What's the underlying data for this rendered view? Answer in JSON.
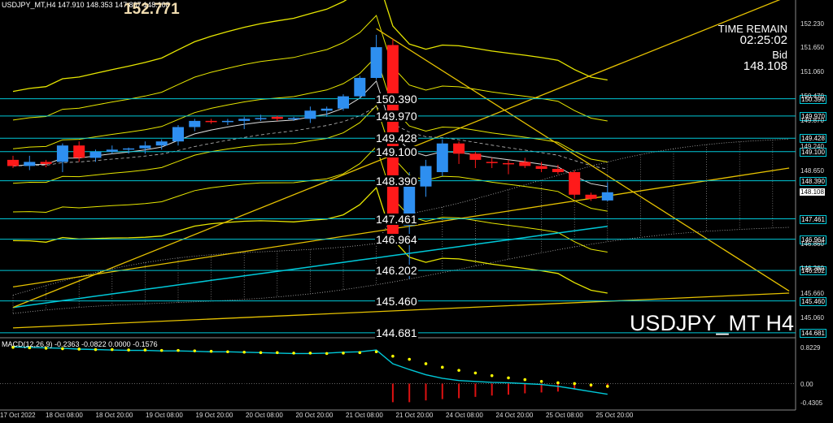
{
  "header": {
    "info": "USDJPY_MT,H4  147.910 148.353 147.887 148.108",
    "big_price": "152.771"
  },
  "panel": {
    "time_label": "TIME REMAIN",
    "time_value": "02:25:02",
    "bid_label": "Bid",
    "bid_value": "148.108"
  },
  "symbol_tf": "USDJPY_MT H4",
  "macd": {
    "label": "MACD(12,26,9) -0.2363 -0.0822 0.0000 -0.1576",
    "axis": [
      "0.8229",
      "0.00",
      "-0.4305"
    ]
  },
  "levels": [
    {
      "value": 150.39,
      "text": "150.390"
    },
    {
      "value": 149.97,
      "text": "149.970"
    },
    {
      "value": 149.428,
      "text": "149.428"
    },
    {
      "value": 149.1,
      "text": "149.100"
    },
    {
      "value": 148.39,
      "text": "148.390"
    },
    {
      "value": 147.461,
      "text": "147.461"
    },
    {
      "value": 146.964,
      "text": "146.964"
    },
    {
      "value": 146.202,
      "text": "146.202"
    },
    {
      "value": 145.46,
      "text": "145.460"
    },
    {
      "value": 144.681,
      "text": "144.681"
    }
  ],
  "y_axis": {
    "labels": [
      {
        "value": 152.23,
        "text": "152.230"
      },
      {
        "value": 151.65,
        "text": "151.650"
      },
      {
        "value": 151.06,
        "text": "151.060"
      },
      {
        "value": 150.47,
        "text": "150.470"
      },
      {
        "value": 149.87,
        "text": "149.870"
      },
      {
        "value": 149.24,
        "text": "149.240"
      },
      {
        "value": 148.65,
        "text": "148.650"
      },
      {
        "value": 146.86,
        "text": "146.860"
      },
      {
        "value": 146.26,
        "text": "146.260"
      },
      {
        "value": 145.66,
        "text": "145.660"
      },
      {
        "value": 145.06,
        "text": "145.060"
      }
    ],
    "current": {
      "value": 148.108,
      "text": "148.108"
    }
  },
  "x_axis": {
    "labels": [
      "17 Oct 2022",
      "18 Oct 08:00",
      "18 Oct 20:00",
      "19 Oct 08:00",
      "19 Oct 20:00",
      "20 Oct 08:00",
      "20 Oct 20:00",
      "21 Oct 08:00",
      "21 Oct 20:00",
      "24 Oct 08:00",
      "24 Oct 20:00",
      "25 Oct 08:00",
      "25 Oct 20:00"
    ]
  },
  "colors": {
    "up": "#2e8ff0",
    "down": "#ff1a1a",
    "level_line": "#00c8d8",
    "band": "#e6e600",
    "trend": "#e6c200",
    "ma": "#dddddd",
    "macd_line": "#00c8d8",
    "signal": "#ffff00",
    "hist": "#dd1111"
  },
  "chart_data": {
    "type": "candlestick",
    "symbol": "USDJPY_MT",
    "timeframe": "H4",
    "y_range": [
      144.6,
      152.8
    ],
    "candles": [
      {
        "o": 148.9,
        "h": 149.0,
        "l": 148.7,
        "c": 148.75
      },
      {
        "o": 148.75,
        "h": 149.0,
        "l": 148.65,
        "c": 148.85
      },
      {
        "o": 148.85,
        "h": 148.9,
        "l": 148.72,
        "c": 148.8
      },
      {
        "o": 148.85,
        "h": 149.3,
        "l": 148.6,
        "c": 149.25
      },
      {
        "o": 149.25,
        "h": 149.35,
        "l": 148.85,
        "c": 148.95
      },
      {
        "o": 148.95,
        "h": 149.15,
        "l": 148.85,
        "c": 149.1
      },
      {
        "o": 149.1,
        "h": 149.25,
        "l": 149.05,
        "c": 149.15
      },
      {
        "o": 149.15,
        "h": 149.2,
        "l": 149.05,
        "c": 149.18
      },
      {
        "o": 149.18,
        "h": 149.35,
        "l": 149.05,
        "c": 149.25
      },
      {
        "o": 149.25,
        "h": 149.4,
        "l": 149.15,
        "c": 149.35
      },
      {
        "o": 149.35,
        "h": 149.75,
        "l": 149.25,
        "c": 149.7
      },
      {
        "o": 149.7,
        "h": 149.9,
        "l": 149.6,
        "c": 149.85
      },
      {
        "o": 149.85,
        "h": 149.9,
        "l": 149.78,
        "c": 149.82
      },
      {
        "o": 149.82,
        "h": 149.9,
        "l": 149.75,
        "c": 149.85
      },
      {
        "o": 149.85,
        "h": 149.95,
        "l": 149.65,
        "c": 149.9
      },
      {
        "o": 149.9,
        "h": 150.0,
        "l": 149.85,
        "c": 149.92
      },
      {
        "o": 149.95,
        "h": 149.98,
        "l": 149.85,
        "c": 149.9
      },
      {
        "o": 149.9,
        "h": 149.95,
        "l": 149.85,
        "c": 149.92
      },
      {
        "o": 149.9,
        "h": 150.2,
        "l": 149.8,
        "c": 150.1
      },
      {
        "o": 150.1,
        "h": 150.2,
        "l": 149.95,
        "c": 150.15
      },
      {
        "o": 150.15,
        "h": 150.5,
        "l": 150.1,
        "c": 150.45
      },
      {
        "o": 150.45,
        "h": 150.95,
        "l": 150.4,
        "c": 150.9
      },
      {
        "o": 150.9,
        "h": 151.95,
        "l": 150.85,
        "c": 151.65
      },
      {
        "o": 151.7,
        "h": 151.85,
        "l": 146.95,
        "c": 147.05
      },
      {
        "o": 147.3,
        "h": 148.6,
        "l": 146.0,
        "c": 148.25
      },
      {
        "o": 148.25,
        "h": 148.9,
        "l": 148.0,
        "c": 148.75
      },
      {
        "o": 148.6,
        "h": 149.4,
        "l": 148.5,
        "c": 149.3
      },
      {
        "o": 149.3,
        "h": 149.35,
        "l": 148.8,
        "c": 149.05
      },
      {
        "o": 149.05,
        "h": 149.1,
        "l": 148.7,
        "c": 148.9
      },
      {
        "o": 148.85,
        "h": 148.95,
        "l": 148.7,
        "c": 148.82
      },
      {
        "o": 148.82,
        "h": 148.9,
        "l": 148.55,
        "c": 148.8
      },
      {
        "o": 148.85,
        "h": 148.95,
        "l": 148.7,
        "c": 148.75
      },
      {
        "o": 148.75,
        "h": 148.85,
        "l": 148.6,
        "c": 148.68
      },
      {
        "o": 148.68,
        "h": 148.78,
        "l": 148.55,
        "c": 148.6
      },
      {
        "o": 148.6,
        "h": 148.65,
        "l": 147.95,
        "c": 148.05
      },
      {
        "o": 148.05,
        "h": 148.1,
        "l": 147.9,
        "c": 147.95
      },
      {
        "o": 147.91,
        "h": 148.35,
        "l": 147.89,
        "c": 148.11
      }
    ],
    "macd": {
      "hist": [
        0.6,
        0.6,
        0.6,
        0.6,
        0.6,
        0.6,
        0.6,
        0.6,
        0.6,
        0.6,
        0.6,
        0.6,
        0.6,
        0.6,
        0.6,
        0.6,
        0.6,
        0.6,
        0.6,
        0.6,
        0.6,
        0.6,
        0.1,
        -0.42,
        -0.42,
        -0.38,
        -0.35,
        -0.33,
        -0.3,
        -0.27,
        -0.25,
        -0.22,
        -0.2,
        -0.18,
        -0.12,
        -0.08,
        -0.1
      ],
      "signal": [
        0.82,
        0.81,
        0.8,
        0.79,
        0.78,
        0.77,
        0.77,
        0.76,
        0.76,
        0.75,
        0.75,
        0.74,
        0.73,
        0.72,
        0.71,
        0.7,
        0.7,
        0.69,
        0.69,
        0.68,
        0.69,
        0.7,
        0.72,
        0.62,
        0.55,
        0.45,
        0.37,
        0.3,
        0.24,
        0.18,
        0.13,
        0.09,
        0.05,
        0.02,
        0.0,
        -0.03,
        -0.06
      ],
      "line": [
        0.83,
        0.82,
        0.81,
        0.8,
        0.78,
        0.77,
        0.76,
        0.75,
        0.75,
        0.74,
        0.74,
        0.73,
        0.72,
        0.72,
        0.71,
        0.7,
        0.69,
        0.68,
        0.68,
        0.69,
        0.71,
        0.72,
        0.76,
        0.45,
        0.32,
        0.2,
        0.12,
        0.07,
        0.05,
        0.03,
        0.02,
        0.0,
        -0.02,
        -0.06,
        -0.12,
        -0.18,
        -0.24
      ],
      "y_range": [
        -0.56,
        1.0
      ]
    }
  }
}
